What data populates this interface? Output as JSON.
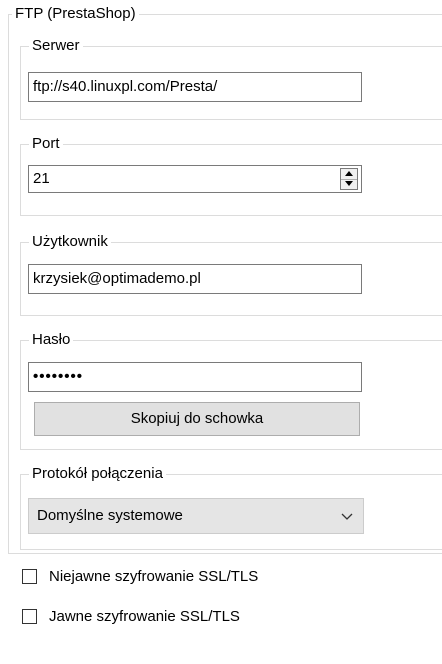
{
  "ftp_group": {
    "title": "FTP (PrestaShop)"
  },
  "server": {
    "label": "Serwer",
    "value": "ftp://s40.linuxpl.com/Presta/"
  },
  "port": {
    "label": "Port",
    "value": "21"
  },
  "user": {
    "label": "Użytkownik",
    "value": "krzysiek@optimademo.pl"
  },
  "password": {
    "label": "Hasło",
    "masked_value": "••••••••",
    "copy_button": "Skopiuj do schowka"
  },
  "protocol": {
    "label": "Protokół połączenia",
    "selected": "Domyślne systemowe"
  },
  "options": [
    {
      "label": "Niejawne szyfrowanie SSL/TLS",
      "checked": false
    },
    {
      "label": "Jawne szyfrowanie SSL/TLS",
      "checked": false
    }
  ]
}
